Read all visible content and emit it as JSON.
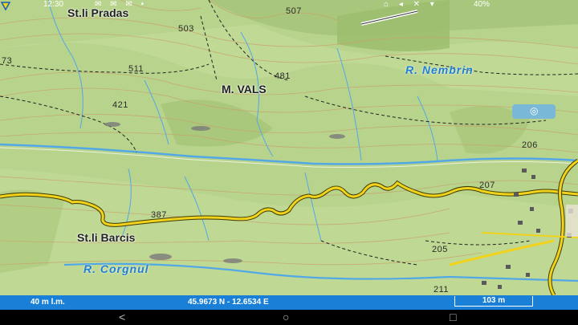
{
  "status_bar": {
    "time": "12:30",
    "battery": "40%",
    "left_icons": "✉ ✉ ✉ •",
    "right_icons": "⌂ ◂ ✕ ▾"
  },
  "map": {
    "peak_labels": [
      "503",
      "507",
      "511",
      "481",
      "421",
      "387",
      "206",
      "207",
      "205",
      "211",
      "73"
    ],
    "place_labels": [
      "St.li Pradas",
      "M. VALS",
      "St.li Barcis"
    ],
    "river_labels": [
      "R. Nembrin",
      "R. Corgnul"
    ],
    "colors": {
      "terrain": "#b5d08a",
      "road": "#f3d21c",
      "water": "#52a8e6",
      "info_bar": "#1a7fd6"
    },
    "icons": [
      "location-marker-icon",
      "poi-icon"
    ]
  },
  "info_bar": {
    "accuracy": "40 m l.m.",
    "coordinates": "45.9673 N - 12.6534 E",
    "scale": "103 m"
  },
  "nav_bar": {
    "back": "<",
    "home": "○",
    "recents": "□"
  }
}
